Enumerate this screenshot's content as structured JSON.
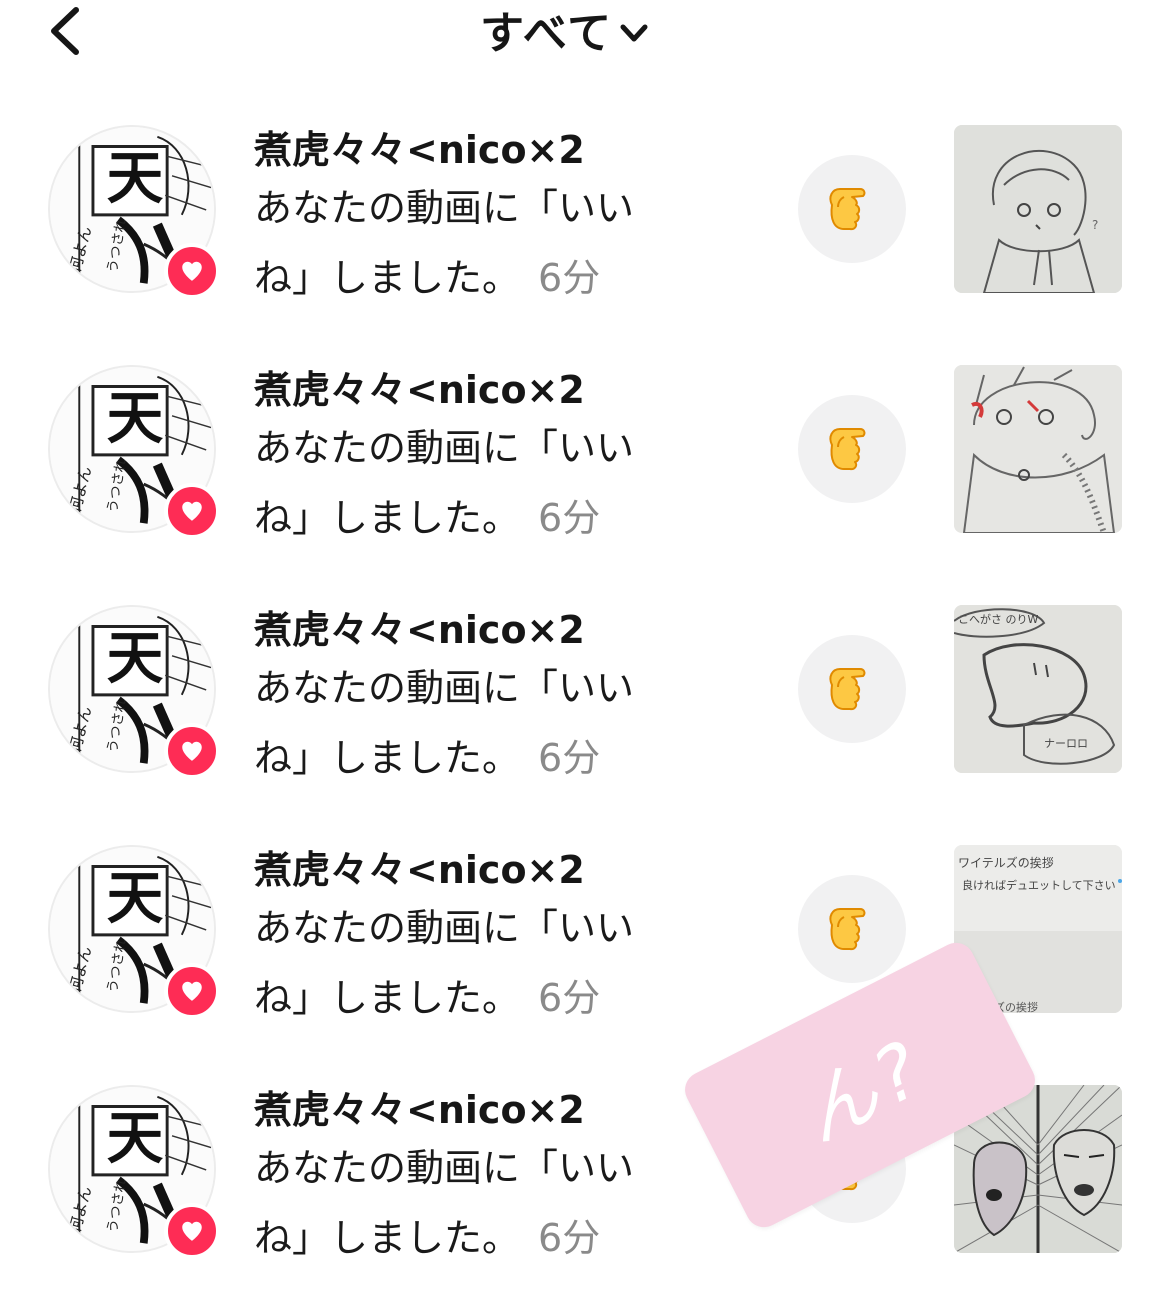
{
  "header": {
    "back_icon": "chevron-left-icon",
    "title": "すべて",
    "dropdown_icon": "chevron-down-icon"
  },
  "notifications": [
    {
      "username": "煮虎々々<nico×2",
      "message_line1": "あなたの動画に「いい",
      "message_line2": "ね」しました。",
      "time": "6分",
      "thumbnail": "sketch-boy-scarf"
    },
    {
      "username": "煮虎々々<nico×2",
      "message_line1": "あなたの動画に「いい",
      "message_line2": "ね」しました。",
      "time": "6分",
      "thumbnail": "sketch-boy-coat"
    },
    {
      "username": "煮虎々々<nico×2",
      "message_line1": "あなたの動画に「いい",
      "message_line2": "ね」しました。",
      "time": "6分",
      "thumbnail": "sketch-speech-bubbles"
    },
    {
      "username": "煮虎々々<nico×2",
      "message_line1": "あなたの動画に「いい",
      "message_line2": "ね」しました。",
      "time": "6分",
      "thumbnail": "handwritten-note"
    },
    {
      "username": "煮虎々々<nico×2",
      "message_line1": "あなたの動画に「いい",
      "message_line2": "ね」しました。",
      "time": "6分",
      "thumbnail": "manga-panels"
    }
  ],
  "sticker": {
    "text": "ん?"
  },
  "colors": {
    "heart_badge": "#fe2c55",
    "like_back_bg": "#f1f1f2",
    "time_text": "#8a8a8a",
    "hand_emoji": "#fdc843",
    "sticker_bg": "#f7d3e3"
  }
}
